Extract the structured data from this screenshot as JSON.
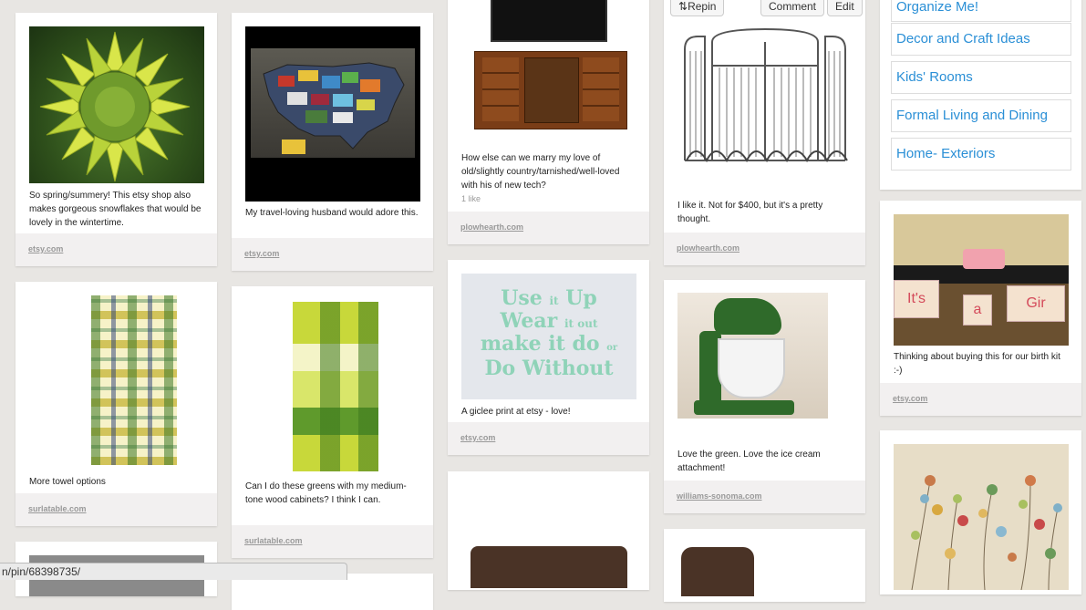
{
  "status_url": "n/pin/68398735/",
  "boards": [
    "Organize Me!",
    "Decor and Craft Ideas",
    "Kids' Rooms",
    "Formal Living and Dining",
    "Home- Exteriors"
  ],
  "buttons": {
    "repin": "Repin",
    "comment": "Comment",
    "edit": "Edit"
  },
  "pins": {
    "star": {
      "desc": "So spring/summery! This etsy shop also makes gorgeous snowflakes that would be lovely in the wintertime.",
      "source": "etsy.com"
    },
    "usmap": {
      "desc": "My travel-loving husband would adore this.",
      "source": "etsy.com"
    },
    "tvstand": {
      "desc": "How else can we marry my love of old/slightly country/tarnished/well-loved with his of new tech?",
      "likes": "1 like",
      "source": "plowhearth.com"
    },
    "screen": {
      "desc": "I like it. Not for $400, but it's a pretty thought.",
      "source": "plowhearth.com"
    },
    "birth": {
      "desc": "Thinking about buying this for our birth kit :-)",
      "source": "etsy.com"
    },
    "towel1": {
      "desc": "More towel options",
      "source": "surlatable.com"
    },
    "towel2": {
      "desc": "Can I do these greens with my medium-tone wood cabinets? I think I can.",
      "source": "surlatable.com"
    },
    "print": {
      "desc": "A giclee print at etsy - love!",
      "source": "etsy.com"
    },
    "mixer": {
      "desc": "Love the green. Love the ice cream attachment!",
      "source": "williams-sonoma.com"
    }
  },
  "poster": {
    "l1a": "Use",
    "l1b": "it",
    "l1c": "Up",
    "l2a": "Wear",
    "l2b": "it out",
    "l3": "make it do",
    "l3b": "or",
    "l4": "Do Without"
  },
  "banner_letters": [
    "It's",
    "a",
    "Gir"
  ],
  "colors": {
    "link": "#2a8fd6",
    "background": "#e8e6e3"
  }
}
